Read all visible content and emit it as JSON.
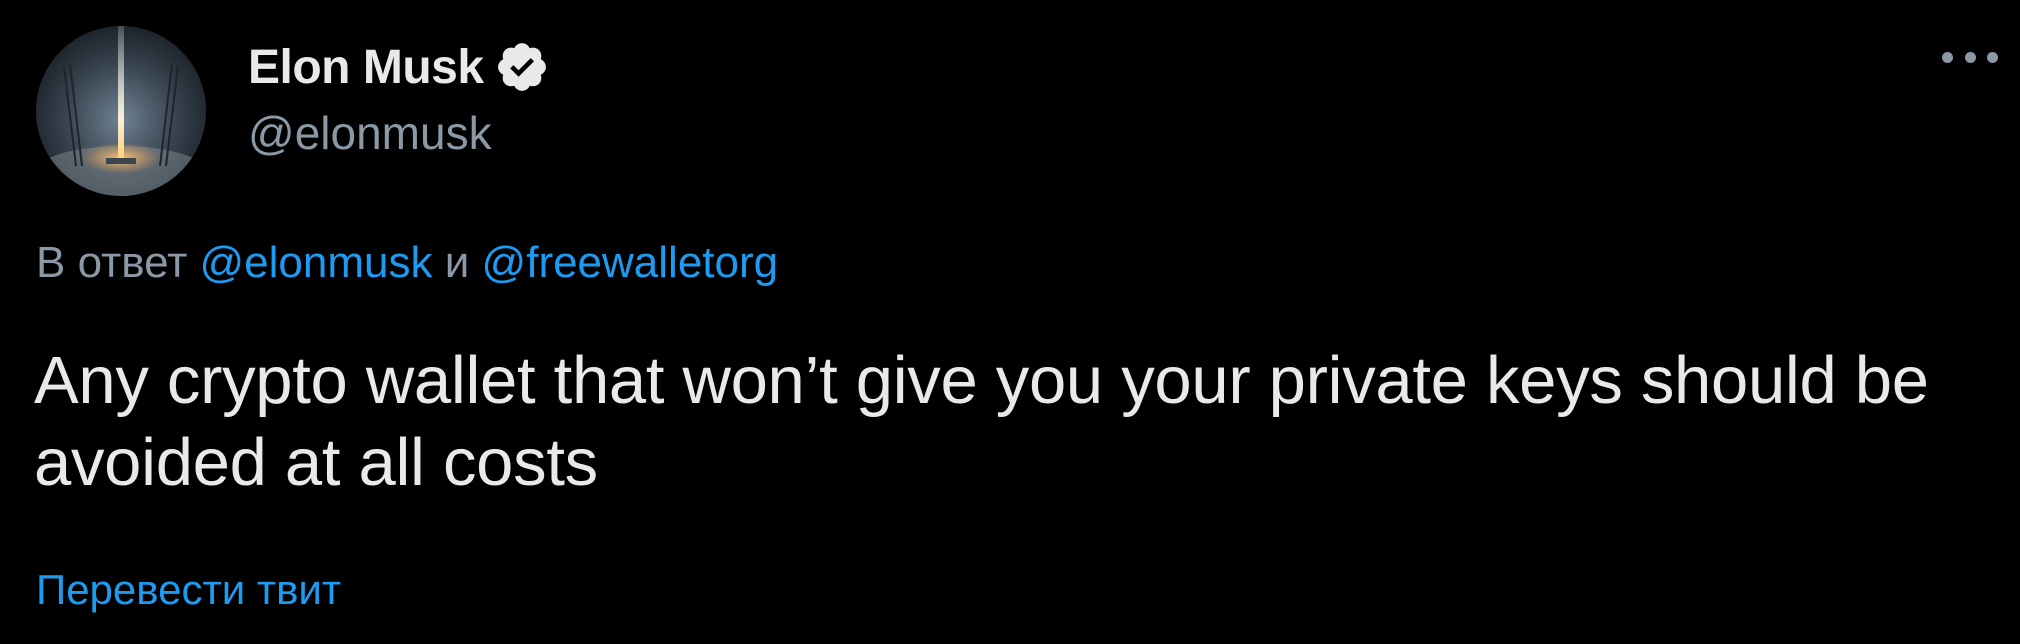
{
  "author": {
    "display_name": "Elon Musk",
    "handle": "@elonmusk",
    "verified": true
  },
  "more_menu_icon": "ellipsis-icon",
  "reply_context": {
    "prefix": "В ответ",
    "user1": "@elonmusk",
    "conjunction": "и",
    "user2": "@freewalletorg"
  },
  "tweet": {
    "text": "Any crypto wallet that won’t give you your private keys should be avoided at all costs"
  },
  "translate_link": "Перевести твит",
  "colors": {
    "background": "#000000",
    "text": "#e7e9ea",
    "secondary": "#8b98a5",
    "accent": "#1d9bf0"
  }
}
